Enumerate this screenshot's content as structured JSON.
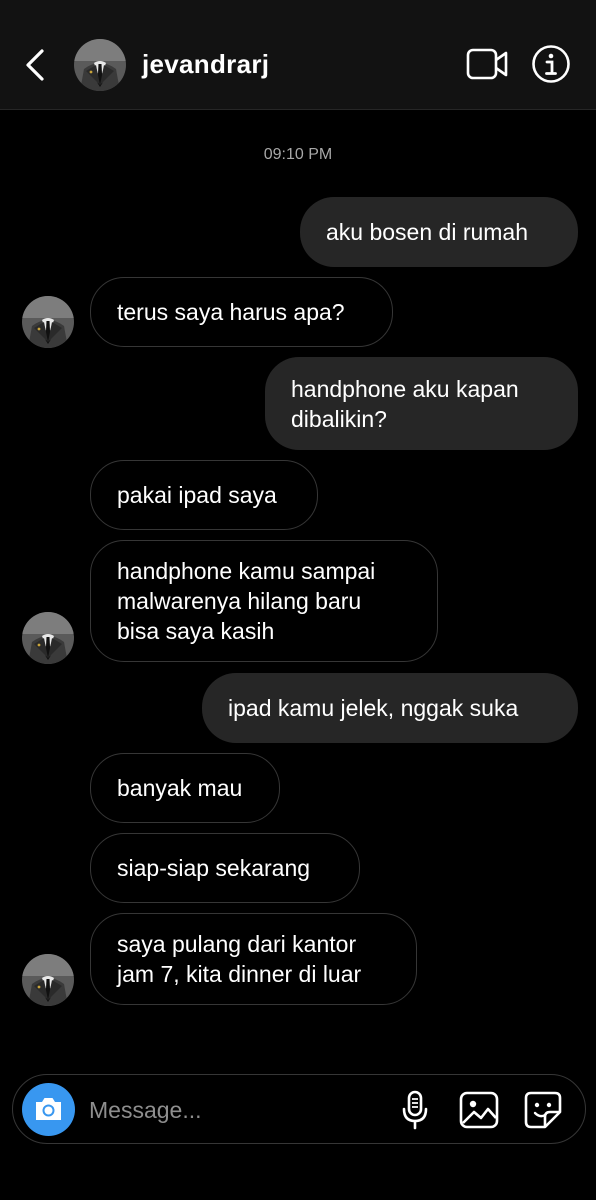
{
  "header": {
    "username": "jevandrarj",
    "icons": {
      "back": "chevron-left-icon",
      "video": "video-call-icon",
      "info": "info-icon"
    }
  },
  "conversation": {
    "timestamp": "09:10 PM",
    "messages": [
      {
        "sender": "me",
        "text": "aku bosen di rumah"
      },
      {
        "sender": "them",
        "text": "terus saya harus apa?"
      },
      {
        "sender": "me",
        "text": "handphone aku kapan\ndibalikin?"
      },
      {
        "sender": "them",
        "text": "pakai ipad saya"
      },
      {
        "sender": "them",
        "text": "handphone kamu sampai\nmalwarenya hilang baru\nbisa saya kasih"
      },
      {
        "sender": "me",
        "text": "ipad kamu jelek, nggak suka"
      },
      {
        "sender": "them",
        "text": "banyak mau"
      },
      {
        "sender": "them",
        "text": "siap-siap sekarang"
      },
      {
        "sender": "them",
        "text": "saya pulang dari kantor\njam 7, kita dinner di luar"
      }
    ]
  },
  "composer": {
    "placeholder": "Message...",
    "icons": {
      "camera": "camera-icon",
      "mic": "microphone-icon",
      "gallery": "gallery-icon",
      "sticker": "sticker-icon"
    }
  },
  "colors": {
    "background": "#000000",
    "header": "#121212",
    "outgoing_bubble": "#262626",
    "incoming_border": "#363636",
    "camera_button": "#3897f0",
    "muted_text": "#a8a8a8"
  }
}
